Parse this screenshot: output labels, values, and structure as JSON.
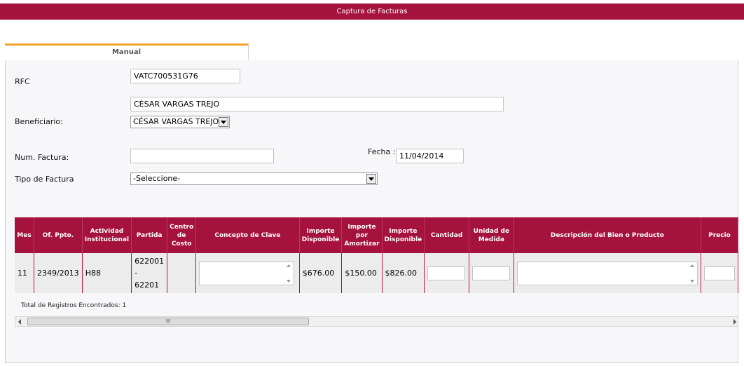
{
  "window": {
    "title": "Captura de Facturas"
  },
  "tabs": [
    {
      "label": "Manual"
    }
  ],
  "form": {
    "rfc_label": "RFC",
    "rfc_value": "VATC700531G76",
    "beneficiario_name_value": "CÉSAR VARGAS TREJO",
    "beneficiario_label": "Beneficiario:",
    "beneficiario_select_value": "CÉSAR VARGAS TREJO",
    "num_factura_label": "Num. Factura:",
    "num_factura_value": "",
    "fecha_label": "Fecha :",
    "fecha_value": "11/04/2014",
    "tipo_factura_label": "Tipo de Factura",
    "tipo_factura_value": "-Seleccione-"
  },
  "table": {
    "headers": [
      "Mes",
      "Of. Ppto.",
      "Actividad Institucional",
      "Partida",
      "Centro de Costo",
      "Concepto de Clave",
      "Importe Disponible",
      "Importe por Amortizar",
      "Importe Disponible",
      "Cantidad",
      "Unidad de Medida",
      "Descripción del Bien o Producto",
      "Precio"
    ],
    "row": {
      "mes": "11",
      "of_ppto": "2349/2013",
      "actividad": "H88",
      "partida_line1": "622001",
      "partida_line2": "-",
      "partida_line3": "62201",
      "centro_costo": "",
      "importe_disponible": "$676.00",
      "importe_por_amortizar": "$150.00",
      "importe_disponible_2": "$826.00"
    }
  },
  "footer": {
    "total_text": "Total de Registros Encontrados: 1",
    "scroll_thumb_text": "III"
  },
  "colors": {
    "accent": "#a6123e",
    "tab_highlight": "#f5a12a"
  }
}
